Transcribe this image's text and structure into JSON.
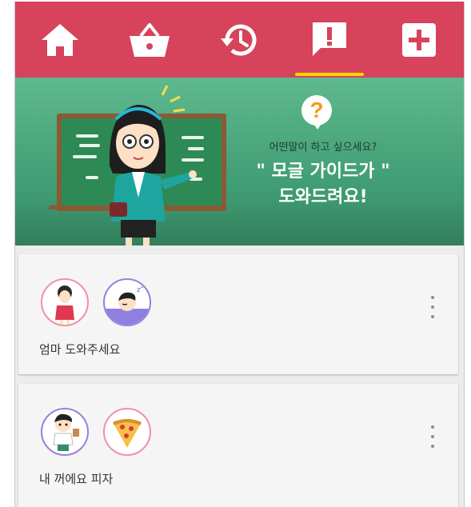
{
  "tabs": [
    {
      "icon": "home-icon",
      "active": false
    },
    {
      "icon": "basket-icon",
      "active": false
    },
    {
      "icon": "history-icon",
      "active": false
    },
    {
      "icon": "alert-message-icon",
      "active": true
    },
    {
      "icon": "add-box-icon",
      "active": false
    }
  ],
  "colors": {
    "tabbar": "#d6435a",
    "active_indicator": "#ffd400",
    "banner": "#4aa57d",
    "card": "#f5f5f5"
  },
  "banner": {
    "question_mark": "?",
    "small_text": "어떤말이 하고 싶으세요?",
    "big_line1": "\" 모글 가이드가 \"",
    "big_line2": "도와드려요!"
  },
  "cards": [
    {
      "title": "엄마 도와주세요",
      "avatars": [
        "mom-avatar-icon",
        "sleeping-avatar-icon"
      ]
    },
    {
      "title": "내 꺼에요 피자",
      "avatars": [
        "boy-avatar-icon",
        "pizza-avatar-icon"
      ]
    }
  ]
}
